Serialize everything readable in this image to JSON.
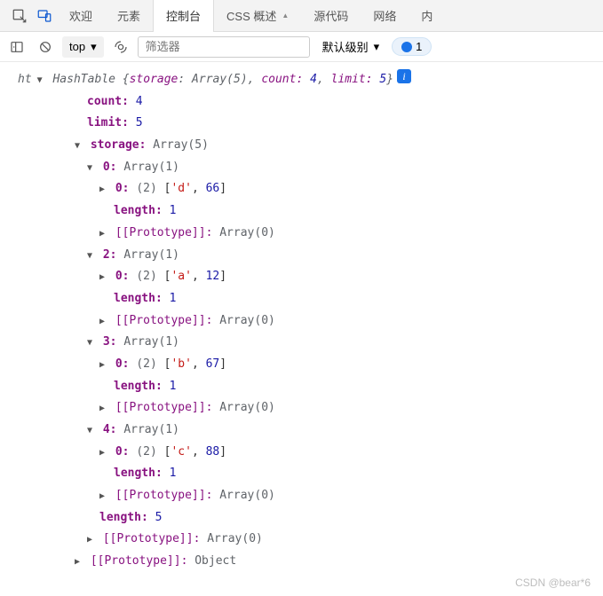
{
  "tabs": {
    "welcome": "欢迎",
    "elements": "元素",
    "console": "控制台",
    "cssOverview": "CSS 概述",
    "sources": "源代码",
    "network": "网络",
    "trailing": "内"
  },
  "toolbar": {
    "context": "top",
    "filterPlaceholder": "筛选器",
    "level": "默认级别",
    "issueCount": "1"
  },
  "log": {
    "var": "ht",
    "summary": {
      "cls": "HashTable",
      "storage": "Array(5)",
      "countLabel": "count:",
      "count": "4",
      "limitLabel": "limit:",
      "limit": "5"
    },
    "countLine": {
      "k": "count:",
      "v": "4"
    },
    "limitLine": {
      "k": "limit:",
      "v": "5"
    },
    "storageLine": {
      "k": "storage:",
      "v": "Array(5)"
    },
    "entries": [
      {
        "idx": "0:",
        "arr": "Array(1)",
        "innerIdx": "0:",
        "innerLen": "(2)",
        "open": "[",
        "s": "'d'",
        "comma": ", ",
        "n": "66",
        "close": "]",
        "lenK": "length:",
        "lenV": "1",
        "protoK": "[[Prototype]]:",
        "protoV": "Array(0)"
      },
      {
        "idx": "2:",
        "arr": "Array(1)",
        "innerIdx": "0:",
        "innerLen": "(2)",
        "open": "[",
        "s": "'a'",
        "comma": ", ",
        "n": "12",
        "close": "]",
        "lenK": "length:",
        "lenV": "1",
        "protoK": "[[Prototype]]:",
        "protoV": "Array(0)"
      },
      {
        "idx": "3:",
        "arr": "Array(1)",
        "innerIdx": "0:",
        "innerLen": "(2)",
        "open": "[",
        "s": "'b'",
        "comma": ", ",
        "n": "67",
        "close": "]",
        "lenK": "length:",
        "lenV": "1",
        "protoK": "[[Prototype]]:",
        "protoV": "Array(0)"
      },
      {
        "idx": "4:",
        "arr": "Array(1)",
        "innerIdx": "0:",
        "innerLen": "(2)",
        "open": "[",
        "s": "'c'",
        "comma": ", ",
        "n": "88",
        "close": "]",
        "lenK": "length:",
        "lenV": "1",
        "protoK": "[[Prototype]]:",
        "protoV": "Array(0)"
      }
    ],
    "storageLen": {
      "k": "length:",
      "v": "5"
    },
    "storageProto": {
      "k": "[[Prototype]]:",
      "v": "Array(0)"
    },
    "rootProto": {
      "k": "[[Prototype]]:",
      "v": "Object"
    }
  },
  "watermark": "CSDN @bear*6"
}
